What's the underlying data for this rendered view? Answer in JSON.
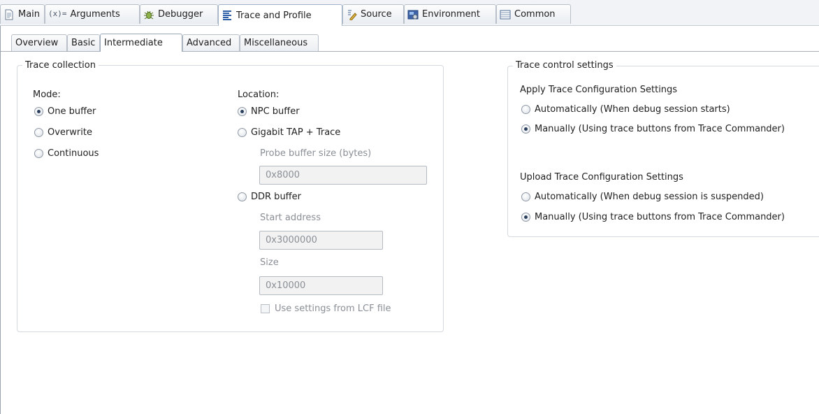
{
  "top_tabs": [
    {
      "label": "Main",
      "icon": "document-icon"
    },
    {
      "label": "Arguments",
      "icon": "arguments-icon",
      "icon_text": "(x)="
    },
    {
      "label": "Debugger",
      "icon": "bug-icon"
    },
    {
      "label": "Trace and Profile",
      "icon": "trace-icon",
      "active": true
    },
    {
      "label": "Source",
      "icon": "source-icon"
    },
    {
      "label": "Environment",
      "icon": "environment-icon"
    },
    {
      "label": "Common",
      "icon": "common-icon"
    }
  ],
  "sub_tabs": [
    {
      "label": "Overview"
    },
    {
      "label": "Basic"
    },
    {
      "label": "Intermediate",
      "active": true
    },
    {
      "label": "Advanced"
    },
    {
      "label": "Miscellaneous"
    }
  ],
  "trace_collection": {
    "title": "Trace collection",
    "mode_label": "Mode:",
    "modes": [
      {
        "label": "One buffer",
        "selected": true
      },
      {
        "label": "Overwrite",
        "selected": false
      },
      {
        "label": "Continuous",
        "selected": false
      }
    ],
    "location_label": "Location:",
    "locations": {
      "npc": {
        "label": "NPC buffer",
        "selected": true
      },
      "gigabit": {
        "label": "Gigabit TAP + Trace",
        "selected": false
      },
      "ddr": {
        "label": "DDR buffer",
        "selected": false
      }
    },
    "probe_buffer_label": "Probe buffer size (bytes)",
    "probe_buffer_value": "0x8000",
    "start_address_label": "Start address",
    "start_address_value": "0x3000000",
    "size_label": "Size",
    "size_value": "0x10000",
    "lcf_checkbox_label": "Use settings from LCF file",
    "lcf_checked": false
  },
  "trace_control": {
    "title": "Trace control settings",
    "apply_heading": "Apply Trace Configuration Settings",
    "apply_options": [
      {
        "label": "Automatically (When debug session starts)",
        "selected": false
      },
      {
        "label": "Manually (Using trace buttons from Trace Commander)",
        "selected": true
      }
    ],
    "upload_heading": "Upload Trace Configuration Settings",
    "upload_options": [
      {
        "label": "Automatically (When debug session is suspended)",
        "selected": false
      },
      {
        "label": "Manually (Using trace buttons from Trace Commander)",
        "selected": true
      }
    ]
  },
  "colors": {
    "accent": "#2a3f5c",
    "border": "#d4d9df",
    "disabled_text": "#8a8f96"
  }
}
